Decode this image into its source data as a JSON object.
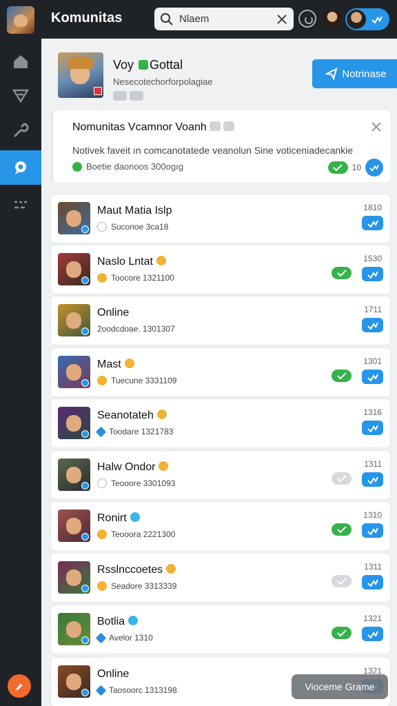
{
  "topbar": {
    "title": "Komunitas",
    "search_value": "Nlaem"
  },
  "profile": {
    "name_part1": "Voy",
    "name_part2": "Gottal",
    "subtitle": "Nesecotechorforpolagiae",
    "action_label": "Notrinase"
  },
  "notice": {
    "title": "Nomunitas Vcamnor Voanh",
    "body": "Notivek faveit ın comcanotatede veanolun Sine voticeniadecankie",
    "meta": "Boetie daonoos 300ogıg",
    "count": "10"
  },
  "members": [
    {
      "name": "Maut Matia Islp",
      "status": "Suconoe 3ca18",
      "count": "1810",
      "status_icon": "grey",
      "check": "none",
      "emoji": "none",
      "colors": [
        "#6b4a2a",
        "#3e6c9a"
      ]
    },
    {
      "name": "Naslo Lntat",
      "status": "Toocore 1321100",
      "count": "1530",
      "status_icon": "yellow",
      "check": "green",
      "emoji": "yellow",
      "colors": [
        "#a03a3a",
        "#3a2a20"
      ]
    },
    {
      "name": "Online",
      "status": "2oodcdoae. 1301307",
      "count": "1711",
      "status_icon": "none",
      "check": "none",
      "emoji": "none",
      "colors": [
        "#c8902a",
        "#3d5a3a"
      ]
    },
    {
      "name": "Mast",
      "status": "Tuecune 3331109",
      "count": "1301",
      "status_icon": "yellow",
      "check": "green",
      "emoji": "yellow",
      "colors": [
        "#3a6ab0",
        "#7a3a5a"
      ]
    },
    {
      "name": "Seanotateh",
      "status": "Toodare 1321783",
      "count": "1316",
      "status_icon": "blue",
      "check": "none",
      "emoji": "yellow",
      "colors": [
        "#5a2a7a",
        "#2a4a3a"
      ]
    },
    {
      "name": "Halw Ondor",
      "status": "Teooore 3301093",
      "count": "1311",
      "status_icon": "grey",
      "check": "grey",
      "emoji": "yellow",
      "colors": [
        "#5a6a4a",
        "#2a2a30"
      ]
    },
    {
      "name": "Ronirt",
      "status": "Teooora 2221300",
      "count": "1310",
      "status_icon": "yellow",
      "check": "green",
      "emoji": "blue",
      "colors": [
        "#a0524a",
        "#4a2a3a"
      ]
    },
    {
      "name": "Rsslnccoetes",
      "status": "Seadore 3313339",
      "count": "1311",
      "status_icon": "yellow",
      "check": "grey",
      "emoji": "yellow",
      "colors": [
        "#7a2a5a",
        "#3a7a3a"
      ]
    },
    {
      "name": "Botlia",
      "status": "Avelor 1310",
      "count": "1321",
      "status_icon": "blue",
      "check": "green",
      "emoji": "blue",
      "colors": [
        "#3a7a3a",
        "#6a8a3a"
      ]
    },
    {
      "name": "Online",
      "status": "Taosoorc 1313198",
      "count": "1321",
      "status_icon": "blue",
      "check": "none",
      "emoji": "none",
      "colors": [
        "#8a4a2a",
        "#3a2a20"
      ]
    }
  ],
  "toast": {
    "label": "Vioceme Grame"
  },
  "colors": {
    "accent": "#2795e8",
    "sidebar_bg": "#1f2226",
    "success": "#35b24a",
    "fab": "#f26b2c"
  }
}
